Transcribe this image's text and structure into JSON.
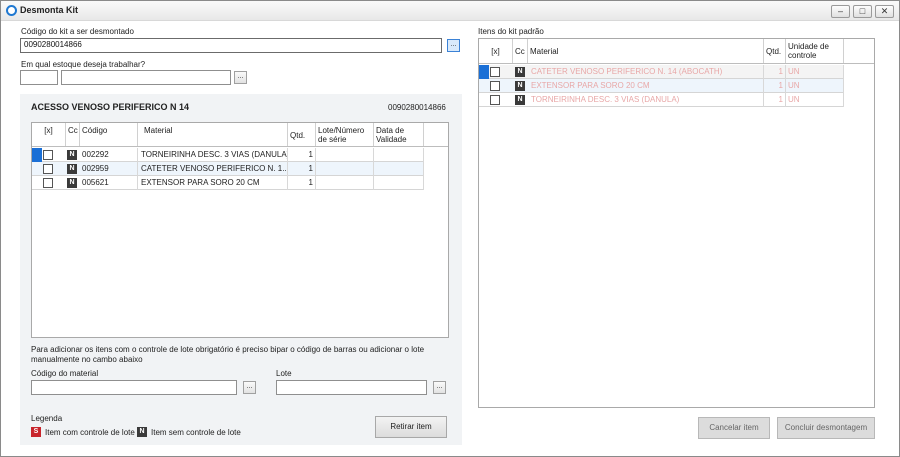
{
  "window": {
    "title": "Desmonta Kit"
  },
  "colors": {
    "selection": "#1a6fd6",
    "badge_s": "#c8252c",
    "badge_n": "#3a3a3a",
    "faded_text": "#e8a7a7"
  },
  "left": {
    "kit_code_label": "Código do kit a ser desmontado",
    "kit_code_value": "0090280014866",
    "stock_label": "Em qual estoque deseja trabalhar?",
    "stock_code_value": "",
    "stock_name_value": "",
    "browse_label": "...",
    "kit_name": "ACESSO VENOSO PERIFERICO N 14",
    "kit_number": "0090280014866",
    "grid": {
      "columns": [
        "[x]",
        "Cc",
        "Código",
        "Material",
        "Qtd.",
        "Lote/Número de série",
        "Data de Validade"
      ],
      "rows": [
        {
          "code": "002292",
          "material": "TORNEIRINHA DESC. 3 VIAS (DANULA)",
          "qty": "1",
          "lot": "",
          "expiry": "",
          "badge": "N"
        },
        {
          "code": "002959",
          "material": "CATETER VENOSO PERIFERICO N. 1...",
          "qty": "1",
          "lot": "",
          "expiry": "",
          "badge": "N"
        },
        {
          "code": "005621",
          "material": "EXTENSOR PARA SORO 20 CM",
          "qty": "1",
          "lot": "",
          "expiry": "",
          "badge": "N"
        }
      ]
    },
    "help_text": "Para adicionar os itens com o controle de lote obrigatório é preciso bipar o código de barras ou adicionar o lote manualmente no cambo abaixo",
    "material_code_label": "Código do material",
    "material_code_value": "",
    "lot_label": "Lote",
    "lot_value": "",
    "legend_title": "Legenda",
    "legend_s": {
      "badge": "S",
      "text": "Item com controle de lote"
    },
    "legend_n": {
      "badge": "N",
      "text": "Item sem controle de lote"
    },
    "remove_button": "Retirar item"
  },
  "right": {
    "title": "Itens do kit padrão",
    "grid": {
      "columns": [
        "[x]",
        "Cc",
        "Material",
        "Qtd.",
        "Unidade de controle"
      ],
      "rows": [
        {
          "material": "CATETER VENOSO PERIFERICO N. 14 (ABOCATH)",
          "qty": "1",
          "unit": "UN",
          "badge": "N"
        },
        {
          "material": "EXTENSOR PARA SORO 20 CM",
          "qty": "1",
          "unit": "UN",
          "badge": "N"
        },
        {
          "material": "TORNEIRINHA DESC. 3 VIAS (DANULA)",
          "qty": "1",
          "unit": "UN",
          "badge": "N"
        }
      ]
    },
    "cancel_button": "Cancelar item",
    "finish_button": "Concluir desmontagem"
  }
}
